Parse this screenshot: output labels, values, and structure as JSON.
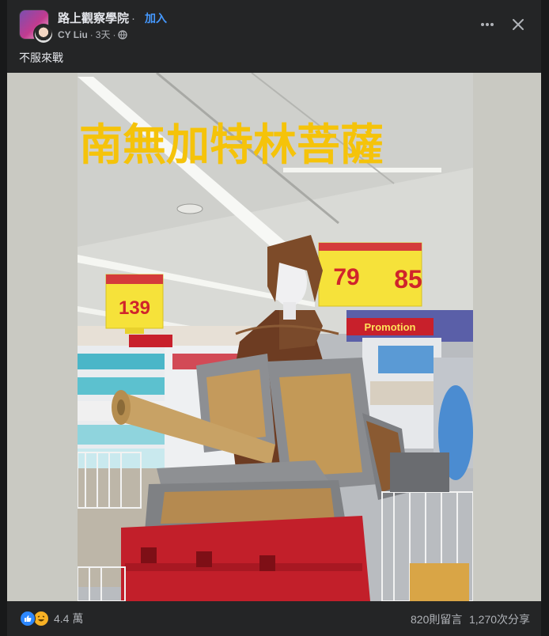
{
  "post": {
    "group_name": "路上觀察學院",
    "separator": "·",
    "join_label": "加入",
    "author": "CY Liu",
    "time": "3天",
    "audience_icon": "globe-icon",
    "caption": "不服來戰"
  },
  "image": {
    "overlay_text": "南無加特林菩薩",
    "overlay_color": "#f5c30a",
    "price_tags": [
      "139",
      "79",
      "85"
    ],
    "promo_banner": "Promotion"
  },
  "footer": {
    "reaction_count": "4.4 萬",
    "comments": "820則留言",
    "shares": "1,270次分享"
  },
  "colors": {
    "background": "#18191a",
    "card": "#242526",
    "link": "#4599ff",
    "secondary_text": "#b0b3b8"
  }
}
